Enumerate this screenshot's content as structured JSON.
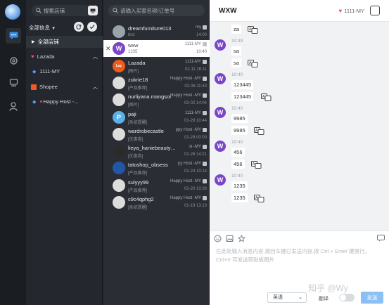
{
  "rail": {
    "items": [
      {
        "icon": "chat-icon",
        "active": true
      },
      {
        "icon": "settings-icon",
        "active": false
      },
      {
        "icon": "device-icon",
        "active": false
      },
      {
        "icon": "user-icon",
        "active": false
      }
    ]
  },
  "sidebar": {
    "search_label": "搜索店铺",
    "all_info_label": "全部信息",
    "all_stores_label": "全部店铺",
    "lazada_label": "Lazada",
    "lazada_store": "1111-MY",
    "shopee_label": "Shopee",
    "shopee_store": "Happy   Host  -..."
  },
  "chatlist": {
    "search_placeholder": "请输入买家名称/订单号",
    "chats": [
      {
        "name": "dreamfurniture013",
        "store": "my",
        "sub": "test",
        "time": "14:00",
        "avatar": "#9aa2ab",
        "letter": ""
      },
      {
        "name": "wxw",
        "store": "1111-MY",
        "sub": "1235",
        "time": "10:40",
        "avatar": "#7a45c9",
        "letter": "W"
      },
      {
        "name": "Lazada",
        "store": "1111-MY",
        "sub": "[图片]",
        "time": "02-11 16:11",
        "avatar": "#f05a1a",
        "letter": "Laz"
      },
      {
        "name": "zukrie18",
        "store": "Happy Host -MY",
        "sub": "[产品推荐]",
        "time": "02-06 11:43",
        "avatar": "#dcdcdc",
        "letter": ""
      },
      {
        "name": "nurliyana.mangsor",
        "store": "Happy Host -MY",
        "sub": "[图片]",
        "time": "02-02 14:04",
        "avatar": "#dcdcdc",
        "letter": ""
      },
      {
        "name": "paji",
        "store": "1111-MY",
        "sub": "[系统提醒]",
        "time": "01-29 10:44",
        "avatar": "#5ab0e8",
        "letter": "P"
      },
      {
        "name": "wardrobecastle",
        "store": "ppy Host -MY",
        "sub": "[优惠券]",
        "time": "01-29 00:00",
        "avatar": "#dcdcdc",
        "letter": ""
      },
      {
        "name": "lieya_haniebeautycare",
        "store": "st -MY",
        "sub": "[优惠券]",
        "time": "01-26 14:21",
        "avatar": "#2b2b2b",
        "letter": ""
      },
      {
        "name": "tatoshop_obsess",
        "store": "py Host -MY",
        "sub": "[产品推荐]",
        "time": "01-24 10:14",
        "avatar": "#2456a8",
        "letter": ""
      },
      {
        "name": "sulyyy99",
        "store": "Happy Host -MY",
        "sub": "[产品推荐]",
        "time": "01-20 10:39",
        "avatar": "#dcdcdc",
        "letter": ""
      },
      {
        "name": "c9c4qphg2",
        "store": "Happy Host -MY",
        "sub": "[系统提醒]",
        "time": "01-19 13:13",
        "avatar": "#dcdcdc",
        "letter": ""
      }
    ]
  },
  "conversation": {
    "title": "WXW",
    "store": "1111-MY",
    "messages": [
      {
        "time": "",
        "texts": [
          "za"
        ]
      },
      {
        "time": "10:39",
        "texts": [
          "sa",
          "sa"
        ]
      },
      {
        "time": "10:40",
        "texts": [
          "123445",
          "123445"
        ]
      },
      {
        "time": "10:40",
        "texts": [
          "9985",
          "9985"
        ]
      },
      {
        "time": "10:40",
        "texts": [
          "456",
          "456"
        ]
      },
      {
        "time": "10:40",
        "texts": [
          "1235",
          "1235"
        ]
      }
    ],
    "avatar_letter": "W",
    "composer_placeholder": "在此处输入消息内容,按回车键已发送内容,按 Ctrl + Enter 键换行。Ctrl+V 可发送剪贴板图片",
    "language": "英语",
    "translate_label": "翻译",
    "send_label": "发送",
    "watermark": "知乎 @Wy"
  }
}
